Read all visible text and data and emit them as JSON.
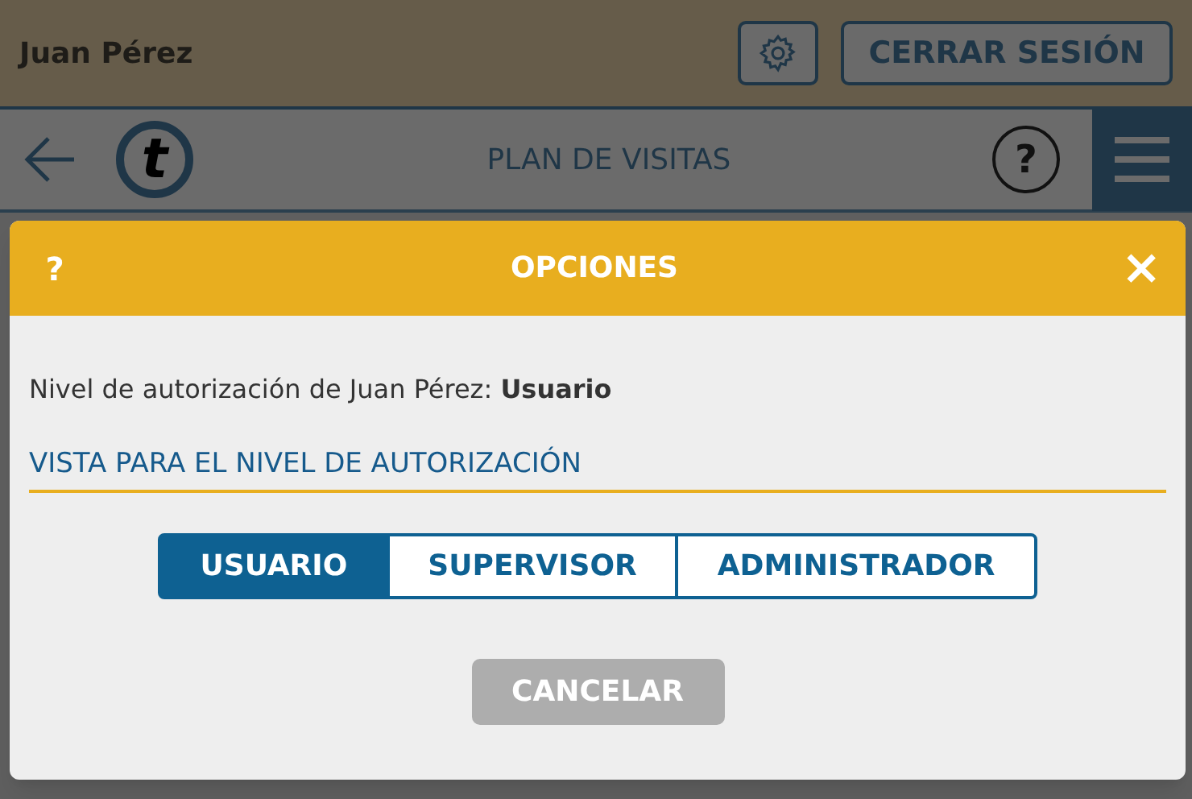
{
  "header": {
    "user_name": "Juan Pérez",
    "logout_button": "CERRAR SESIÓN"
  },
  "navbar": {
    "logo": "t",
    "title": "PLAN DE VISITAS",
    "help": "?"
  },
  "dialog": {
    "help": "?",
    "title": "OPCIONES",
    "close": "×",
    "authorization_text": "Nivel de autorización de Juan Pérez: **Usuario**",
    "section_title": "VISTA PARA EL NIVEL DE AUTORIZACIÓN",
    "view_options": [
      {
        "label": "USUARIO",
        "selected": true
      },
      {
        "label": "SUPERVISOR",
        "selected": false
      },
      {
        "label": "ADMINISTRADOR",
        "selected": false
      }
    ],
    "cancel_button": "CANCELAR"
  }
}
